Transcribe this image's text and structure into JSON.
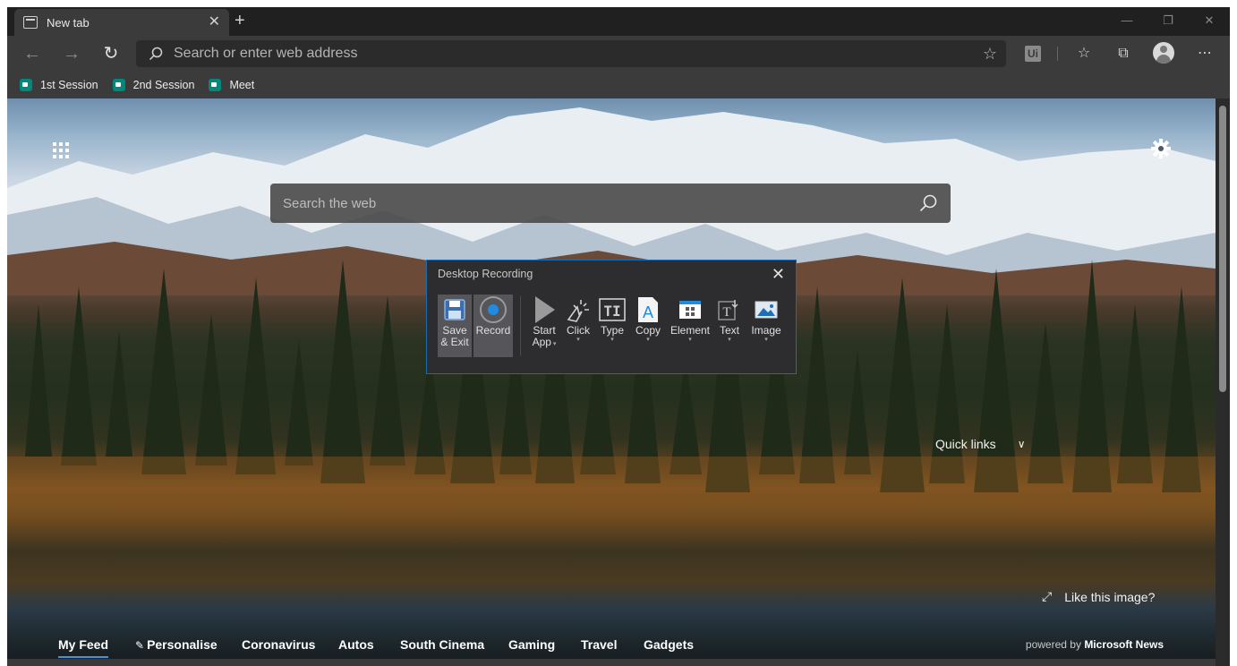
{
  "browser": {
    "tab": {
      "title": "New tab",
      "close_glyph": "✕"
    },
    "new_tab_glyph": "+",
    "window_controls": [
      "—",
      "❐",
      "✕"
    ],
    "address_bar": {
      "placeholder": "Search or enter web address"
    },
    "extension_label": "Ui",
    "bookmarks": [
      {
        "label": "1st Session",
        "icon": "google-meet-icon"
      },
      {
        "label": "2nd Session",
        "icon": "google-meet-icon"
      },
      {
        "label": "Meet",
        "icon": "google-meet-icon"
      }
    ]
  },
  "newtab": {
    "search_placeholder": "Search the web",
    "quick_links_label": "Quick links",
    "like_image_label": "Like this image?",
    "feed_nav": [
      "My Feed",
      "Personalise",
      "Coronavirus",
      "Autos",
      "South Cinema",
      "Gaming",
      "Travel",
      "Gadgets"
    ],
    "powered_by_prefix": "powered by",
    "powered_by_brand": "Microsoft News"
  },
  "recorder": {
    "title": "Desktop Recording",
    "close_glyph": "✕",
    "save_label_1": "Save",
    "save_label_2": "& Exit",
    "record_label": "Record",
    "tools": [
      {
        "label": "Start",
        "label2": "App",
        "icon": "play-icon"
      },
      {
        "label": "Click",
        "icon": "click-icon"
      },
      {
        "label": "Type",
        "icon": "type-icon"
      },
      {
        "label": "Copy",
        "icon": "copy-icon"
      },
      {
        "label": "Element",
        "icon": "element-icon"
      },
      {
        "label": "Text",
        "icon": "text-icon"
      },
      {
        "label": "Image",
        "icon": "image-icon"
      }
    ]
  },
  "colors": {
    "accent": "#3a96dd",
    "recorder_border": "#1b6ab4",
    "meet_green": "#00897b"
  }
}
